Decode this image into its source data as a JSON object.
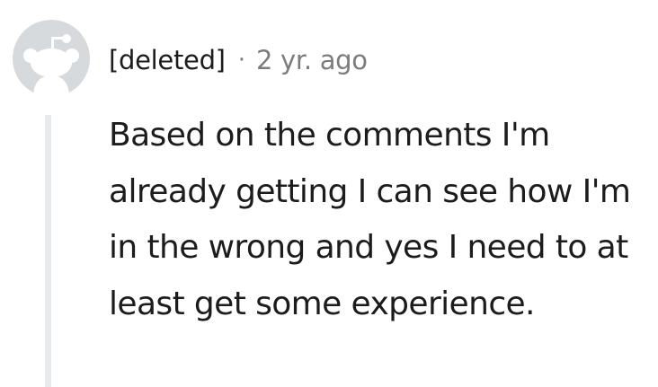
{
  "comment": {
    "author": "[deleted]",
    "separator": "·",
    "timestamp": "2 yr. ago",
    "avatar_icon": "reddit-snoo-avatar-icon",
    "body": "Based on the comments I'm already getting I can see how I'm in the wrong and yes I need to at least get some experience."
  },
  "colors": {
    "text_primary": "#1c1c1c",
    "text_secondary": "#7c7c7c",
    "avatar_bg": "#d7dadc",
    "thread_line": "#e8e9ea"
  }
}
